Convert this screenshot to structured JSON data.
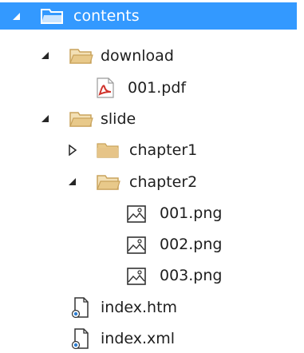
{
  "tree": {
    "root": {
      "label": "contents",
      "expanded": true,
      "selected": true,
      "icon": "folder-open-icon"
    },
    "download": {
      "label": "download",
      "expanded": true,
      "icon": "folder-open-icon"
    },
    "file_001_pdf": {
      "label": "001.pdf",
      "icon": "pdf-file-icon"
    },
    "slide": {
      "label": "slide",
      "expanded": true,
      "icon": "folder-open-icon"
    },
    "chapter1": {
      "label": "chapter1",
      "expanded": false,
      "icon": "folder-closed-icon"
    },
    "chapter2": {
      "label": "chapter2",
      "expanded": true,
      "icon": "folder-open-icon"
    },
    "file_001_png": {
      "label": "001.png",
      "icon": "image-file-icon"
    },
    "file_002_png": {
      "label": "002.png",
      "icon": "image-file-icon"
    },
    "file_003_png": {
      "label": "003.png",
      "icon": "image-file-icon"
    },
    "index_htm": {
      "label": "index.htm",
      "icon": "web-file-icon"
    },
    "index_xml": {
      "label": "index.xml",
      "icon": "web-file-icon"
    }
  },
  "colors": {
    "selection": "#3399ff",
    "folder": "#e8c98a",
    "folder_dark": "#c9a35c",
    "pdf": "#d0342c",
    "arrow": "#262626"
  }
}
